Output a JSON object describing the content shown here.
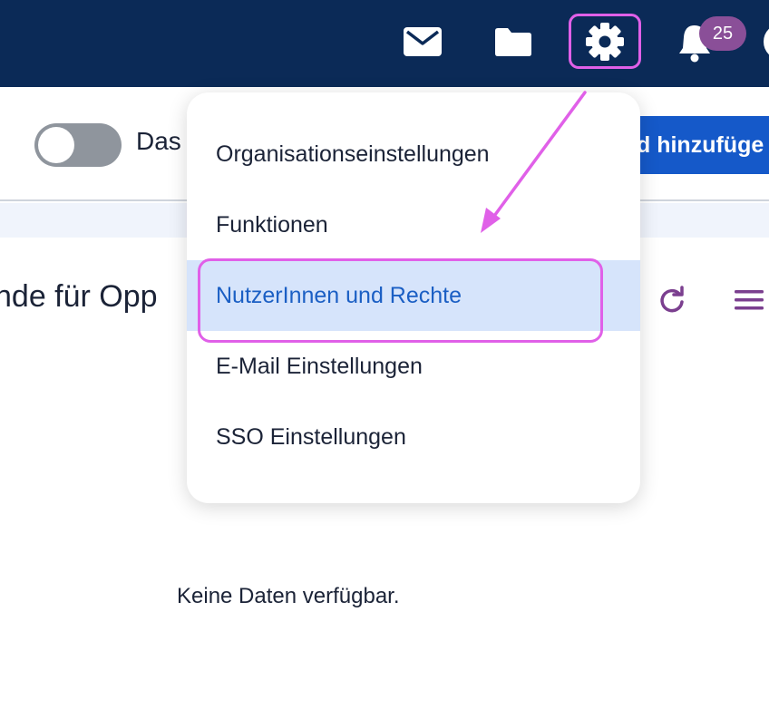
{
  "header": {
    "notification_count": "25",
    "icons": [
      "mail-icon",
      "folder-icon",
      "gear-icon",
      "bell-icon",
      "avatar"
    ]
  },
  "toolbar": {
    "toggle_label": "Das",
    "add_button_label": "d hinzufüge"
  },
  "main": {
    "section_title": "nde für Opp",
    "empty_message": "Keine Daten verfügbar."
  },
  "settings_menu": {
    "items": [
      {
        "label": "Organisationseinstellungen"
      },
      {
        "label": "Funktionen"
      },
      {
        "label": "NutzerInnen und Rechte",
        "highlighted": true
      },
      {
        "label": "E-Mail Einstellungen"
      },
      {
        "label": "SSO Einstellungen"
      }
    ]
  },
  "colors": {
    "header_bg": "#0b2a57",
    "primary_button": "#1559c9",
    "annotation": "#e060e8",
    "active_item_bg": "#d6e4fb",
    "badge_bg": "#8a4f98"
  }
}
